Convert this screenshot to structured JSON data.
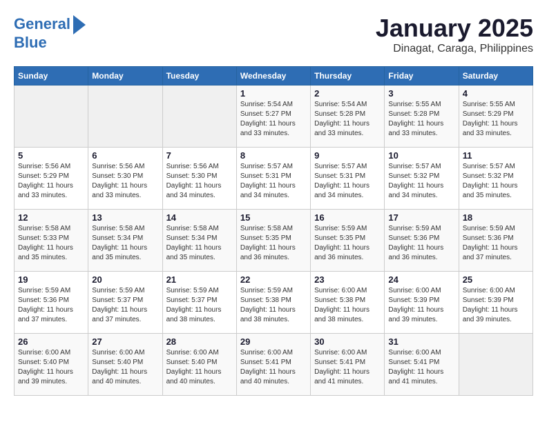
{
  "logo": {
    "line1": "General",
    "line2": "Blue"
  },
  "title": "January 2025",
  "subtitle": "Dinagat, Caraga, Philippines",
  "days_of_week": [
    "Sunday",
    "Monday",
    "Tuesday",
    "Wednesday",
    "Thursday",
    "Friday",
    "Saturday"
  ],
  "weeks": [
    [
      {
        "day": "",
        "info": ""
      },
      {
        "day": "",
        "info": ""
      },
      {
        "day": "",
        "info": ""
      },
      {
        "day": "1",
        "info": "Sunrise: 5:54 AM\nSunset: 5:27 PM\nDaylight: 11 hours\nand 33 minutes."
      },
      {
        "day": "2",
        "info": "Sunrise: 5:54 AM\nSunset: 5:28 PM\nDaylight: 11 hours\nand 33 minutes."
      },
      {
        "day": "3",
        "info": "Sunrise: 5:55 AM\nSunset: 5:28 PM\nDaylight: 11 hours\nand 33 minutes."
      },
      {
        "day": "4",
        "info": "Sunrise: 5:55 AM\nSunset: 5:29 PM\nDaylight: 11 hours\nand 33 minutes."
      }
    ],
    [
      {
        "day": "5",
        "info": "Sunrise: 5:56 AM\nSunset: 5:29 PM\nDaylight: 11 hours\nand 33 minutes."
      },
      {
        "day": "6",
        "info": "Sunrise: 5:56 AM\nSunset: 5:30 PM\nDaylight: 11 hours\nand 33 minutes."
      },
      {
        "day": "7",
        "info": "Sunrise: 5:56 AM\nSunset: 5:30 PM\nDaylight: 11 hours\nand 34 minutes."
      },
      {
        "day": "8",
        "info": "Sunrise: 5:57 AM\nSunset: 5:31 PM\nDaylight: 11 hours\nand 34 minutes."
      },
      {
        "day": "9",
        "info": "Sunrise: 5:57 AM\nSunset: 5:31 PM\nDaylight: 11 hours\nand 34 minutes."
      },
      {
        "day": "10",
        "info": "Sunrise: 5:57 AM\nSunset: 5:32 PM\nDaylight: 11 hours\nand 34 minutes."
      },
      {
        "day": "11",
        "info": "Sunrise: 5:57 AM\nSunset: 5:32 PM\nDaylight: 11 hours\nand 35 minutes."
      }
    ],
    [
      {
        "day": "12",
        "info": "Sunrise: 5:58 AM\nSunset: 5:33 PM\nDaylight: 11 hours\nand 35 minutes."
      },
      {
        "day": "13",
        "info": "Sunrise: 5:58 AM\nSunset: 5:34 PM\nDaylight: 11 hours\nand 35 minutes."
      },
      {
        "day": "14",
        "info": "Sunrise: 5:58 AM\nSunset: 5:34 PM\nDaylight: 11 hours\nand 35 minutes."
      },
      {
        "day": "15",
        "info": "Sunrise: 5:58 AM\nSunset: 5:35 PM\nDaylight: 11 hours\nand 36 minutes."
      },
      {
        "day": "16",
        "info": "Sunrise: 5:59 AM\nSunset: 5:35 PM\nDaylight: 11 hours\nand 36 minutes."
      },
      {
        "day": "17",
        "info": "Sunrise: 5:59 AM\nSunset: 5:36 PM\nDaylight: 11 hours\nand 36 minutes."
      },
      {
        "day": "18",
        "info": "Sunrise: 5:59 AM\nSunset: 5:36 PM\nDaylight: 11 hours\nand 37 minutes."
      }
    ],
    [
      {
        "day": "19",
        "info": "Sunrise: 5:59 AM\nSunset: 5:36 PM\nDaylight: 11 hours\nand 37 minutes."
      },
      {
        "day": "20",
        "info": "Sunrise: 5:59 AM\nSunset: 5:37 PM\nDaylight: 11 hours\nand 37 minutes."
      },
      {
        "day": "21",
        "info": "Sunrise: 5:59 AM\nSunset: 5:37 PM\nDaylight: 11 hours\nand 38 minutes."
      },
      {
        "day": "22",
        "info": "Sunrise: 5:59 AM\nSunset: 5:38 PM\nDaylight: 11 hours\nand 38 minutes."
      },
      {
        "day": "23",
        "info": "Sunrise: 6:00 AM\nSunset: 5:38 PM\nDaylight: 11 hours\nand 38 minutes."
      },
      {
        "day": "24",
        "info": "Sunrise: 6:00 AM\nSunset: 5:39 PM\nDaylight: 11 hours\nand 39 minutes."
      },
      {
        "day": "25",
        "info": "Sunrise: 6:00 AM\nSunset: 5:39 PM\nDaylight: 11 hours\nand 39 minutes."
      }
    ],
    [
      {
        "day": "26",
        "info": "Sunrise: 6:00 AM\nSunset: 5:40 PM\nDaylight: 11 hours\nand 39 minutes."
      },
      {
        "day": "27",
        "info": "Sunrise: 6:00 AM\nSunset: 5:40 PM\nDaylight: 11 hours\nand 40 minutes."
      },
      {
        "day": "28",
        "info": "Sunrise: 6:00 AM\nSunset: 5:40 PM\nDaylight: 11 hours\nand 40 minutes."
      },
      {
        "day": "29",
        "info": "Sunrise: 6:00 AM\nSunset: 5:41 PM\nDaylight: 11 hours\nand 40 minutes."
      },
      {
        "day": "30",
        "info": "Sunrise: 6:00 AM\nSunset: 5:41 PM\nDaylight: 11 hours\nand 41 minutes."
      },
      {
        "day": "31",
        "info": "Sunrise: 6:00 AM\nSunset: 5:41 PM\nDaylight: 11 hours\nand 41 minutes."
      },
      {
        "day": "",
        "info": ""
      }
    ]
  ]
}
